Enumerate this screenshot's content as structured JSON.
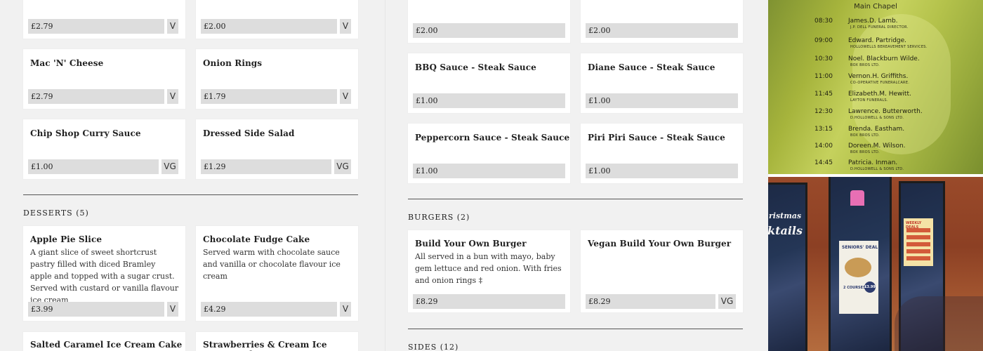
{
  "left": {
    "top_row": [
      {
        "price": "£2.79",
        "tag": "V"
      },
      {
        "price": "£2.00",
        "tag": "V"
      }
    ],
    "row2": [
      {
        "title": "Mac 'N' Cheese",
        "price": "£2.79",
        "tag": "V"
      },
      {
        "title": "Onion Rings",
        "price": "£1.79",
        "tag": "V"
      }
    ],
    "row3": [
      {
        "title": "Chip Shop Curry Sauce",
        "price": "£1.00",
        "tag": "VG"
      },
      {
        "title": "Dressed Side Salad",
        "price": "£1.29",
        "tag": "VG"
      }
    ],
    "desserts_heading": "DESSERTS (5)",
    "desserts": [
      {
        "title": "Apple Pie Slice",
        "desc": "A giant slice of sweet shortcrust pastry filled with diced Bramley apple and topped with a sugar crust. Served with custard or vanilla flavour ice cream",
        "price": "£3.99",
        "tag": "V"
      },
      {
        "title": "Chocolate Fudge Cake",
        "desc": "Served warm with chocolate sauce and vanilla or chocolate flavour ice cream",
        "price": "£4.29",
        "tag": "V"
      },
      {
        "title": "Salted Caramel Ice Cream Cake"
      },
      {
        "title": "Strawberries & Cream Ice Cream Cake"
      }
    ]
  },
  "mid": {
    "top_row": [
      {
        "price": "£2.00"
      },
      {
        "price": "£2.00"
      }
    ],
    "row2": [
      {
        "title": "BBQ Sauce - Steak Sauce",
        "price": "£1.00"
      },
      {
        "title": "Diane Sauce - Steak Sauce",
        "price": "£1.00"
      }
    ],
    "row3": [
      {
        "title": "Peppercorn Sauce - Steak Sauce",
        "price": "£1.00"
      },
      {
        "title": "Piri Piri Sauce - Steak Sauce",
        "price": "£1.00"
      }
    ],
    "burgers_heading": "BURGERS (2)",
    "burgers": [
      {
        "title": "Build Your Own Burger",
        "desc": "All served in a bun with mayo, baby gem lettuce and red onion. With fries and onion rings ‡",
        "price": "£8.29"
      },
      {
        "title": "Vegan Build Your Own Burger",
        "price": "£8.29",
        "tag": "VG"
      }
    ],
    "sides_heading": "SIDES (12)"
  },
  "photos": {
    "schedule_heading": "Main Chapel",
    "schedule": [
      {
        "time": "08:30",
        "name": "James.D. Lamb.",
        "firm": "J.P. DELL FUNERAL DIRECTOR."
      },
      {
        "time": "09:00",
        "name": "Edward. Partridge.",
        "firm": "HOLLOWELLS BEREAVEMENT SERVICES."
      },
      {
        "time": "10:30",
        "name": "Noel. Blackburn Wilde.",
        "firm": "BOX BROS LTD."
      },
      {
        "time": "11:00",
        "name": "Vernon.H. Griffiths.",
        "firm": "CO-OPERATIVE FUNERALCARE."
      },
      {
        "time": "11:45",
        "name": "Elizabeth.M. Hewitt.",
        "firm": "LAYTON FUNERALS."
      },
      {
        "time": "12:30",
        "name": "Lawrence. Butterworth.",
        "firm": "D.HOLLOWELL & SONS LTD."
      },
      {
        "time": "13:15",
        "name": "Brenda. Eastham.",
        "firm": "BOX BROS LTD."
      },
      {
        "time": "14:00",
        "name": "Doreen.M. Wilson.",
        "firm": "BOX BROS LTD."
      },
      {
        "time": "14:45",
        "name": "Patricia. Inman.",
        "firm": "D.HOLLOWELL & SONS LTD."
      }
    ],
    "window_signs": {
      "neon_1": "ristmas",
      "neon_2": "ktails",
      "poster_1_title": "SENIORS' DEAL",
      "poster_1_sub": "2 COURSES",
      "poster_1_price": "£3.99",
      "poster_2_title": "WEEKLY DEALS"
    }
  }
}
